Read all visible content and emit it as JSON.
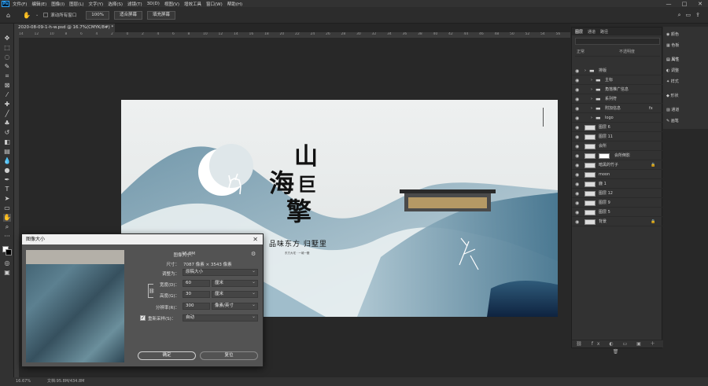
{
  "menubar": {
    "items": [
      "文件(F)",
      "编辑(E)",
      "图像(I)",
      "图层(L)",
      "文字(Y)",
      "选择(S)",
      "滤镜(T)",
      "3D(D)",
      "视图(V)",
      "增效工具",
      "窗口(W)",
      "帮助(H)"
    ],
    "window": {
      "min": "—",
      "max": "□",
      "close": "✕"
    }
  },
  "options": {
    "scroll_all": "滚动所有窗口",
    "zoom": "100%",
    "fit_screen": "适合屏幕",
    "fill_screen": "填充屏幕"
  },
  "document": {
    "tab": "2020-08-09-1-h-w.psd @ 16.7%(CMYK/8#) *",
    "tab_close": "×"
  },
  "ruler": {
    "ticks": [
      "14",
      "12",
      "10",
      "8",
      "6",
      "4",
      "2",
      "0",
      "2",
      "4",
      "6",
      "8",
      "10",
      "12",
      "14",
      "16",
      "18",
      "20",
      "22",
      "24",
      "26",
      "28",
      "30",
      "32",
      "34",
      "36",
      "38",
      "40",
      "42",
      "44",
      "46",
      "48",
      "50",
      "52",
      "54",
      "56"
    ]
  },
  "artwork": {
    "title_chars": [
      "山",
      "海",
      "巨",
      "擎"
    ],
    "slogan": "品味东方 归墅里",
    "small_text": "东方大宅 · 一城一墅"
  },
  "dialog": {
    "title": "图像大小",
    "close": "✕",
    "size_label": "图像大小：",
    "size_value": "95.8M",
    "dim_label": "尺寸：",
    "dim_value": "7087 像素 × 3543 像素",
    "fit_label": "调整为：",
    "fit_value": "原稿大小",
    "width_label": "宽度(D)：",
    "width_value": "60",
    "width_unit": "厘米",
    "height_label": "高度(G)：",
    "height_value": "30",
    "height_unit": "厘米",
    "res_label": "分辨率(R)：",
    "res_value": "300",
    "res_unit": "像素/英寸",
    "resample_label": "重新采样(S)：",
    "resample_value": "自动",
    "ok": "确定",
    "cancel": "复位"
  },
  "layers": {
    "tabs": [
      "图层",
      "通道",
      "路径"
    ],
    "kind": "正常",
    "opacity": "不透明度",
    "rows": [
      {
        "name": "排版",
        "type": "folder",
        "indent": 0
      },
      {
        "name": "主标",
        "type": "folder",
        "indent": 1
      },
      {
        "name": "角落推广信息",
        "type": "folder",
        "indent": 1
      },
      {
        "name": "系列符",
        "type": "folder",
        "indent": 1
      },
      {
        "name": "附加信息",
        "type": "folder",
        "indent": 1,
        "fx": "fx"
      },
      {
        "name": "logo",
        "type": "folder",
        "indent": 1
      },
      {
        "name": "图层 6",
        "type": "layer",
        "indent": 0
      },
      {
        "name": "图层 11",
        "type": "layer",
        "indent": 0
      },
      {
        "name": "会所",
        "type": "layer",
        "indent": 0
      },
      {
        "name": "会所倒影",
        "type": "mask",
        "indent": 0
      },
      {
        "name": "暗黑的竹子",
        "type": "layer",
        "indent": 0,
        "lock": "🔒"
      },
      {
        "name": "moon",
        "type": "layer",
        "indent": 0
      },
      {
        "name": "鹿 1",
        "type": "layer",
        "indent": 0
      },
      {
        "name": "图层 12",
        "type": "layer",
        "indent": 0
      },
      {
        "name": "图层 9",
        "type": "layer",
        "indent": 0
      },
      {
        "name": "图层 5",
        "type": "layer",
        "indent": 0
      },
      {
        "name": "背景",
        "type": "layer",
        "indent": 0,
        "lock": "🔒"
      }
    ],
    "footer": "⛓ fx ◐ ▭ ▣ ＋ 🗑"
  },
  "side": {
    "items": [
      "颜色",
      "色板",
      "属性",
      "调整",
      "样式",
      "形状",
      "通道",
      "画笔"
    ]
  },
  "status": {
    "zoom": "16.67%",
    "doc": "文档:95.8M/434.8M"
  }
}
